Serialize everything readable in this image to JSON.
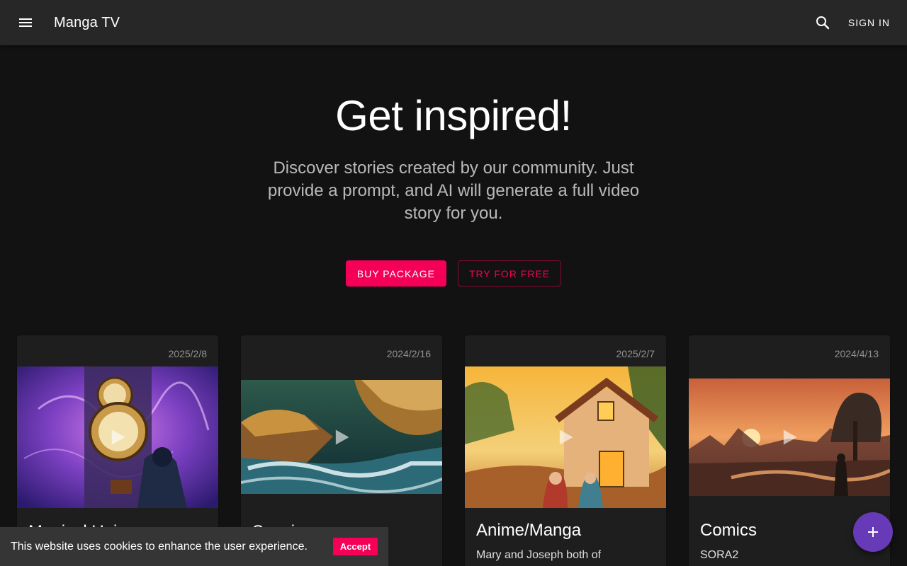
{
  "app": {
    "title": "Manga TV",
    "signin_label": "SIGN IN"
  },
  "icons": {
    "menu": "menu-icon",
    "search": "search-icon",
    "play": "play-icon",
    "add": "add-icon"
  },
  "colors": {
    "primary": "#f50057",
    "appbar": "#272727",
    "background": "#121212",
    "card": "#1e1e1e",
    "fab": "#673ab7"
  },
  "hero": {
    "title": "Get inspired!",
    "description": "Discover stories created by our community. Just provide a prompt, and AI will generate a full video story for you.",
    "buy_label": "BUY PACKAGE",
    "try_label": "TRY FOR FREE"
  },
  "cards": [
    {
      "date": "2025/2/8",
      "title": "Magical Uni…",
      "description": ""
    },
    {
      "date": "2024/2/16",
      "title": "Scenic…",
      "description": ""
    },
    {
      "date": "2025/2/7",
      "title": "Anime/Manga",
      "description": "Mary and Joseph both of"
    },
    {
      "date": "2024/4/13",
      "title": "Comics",
      "description": "SORA2"
    }
  ],
  "cookie": {
    "text": "This website uses cookies to enhance the user experience.",
    "accept_label": "Accept"
  }
}
